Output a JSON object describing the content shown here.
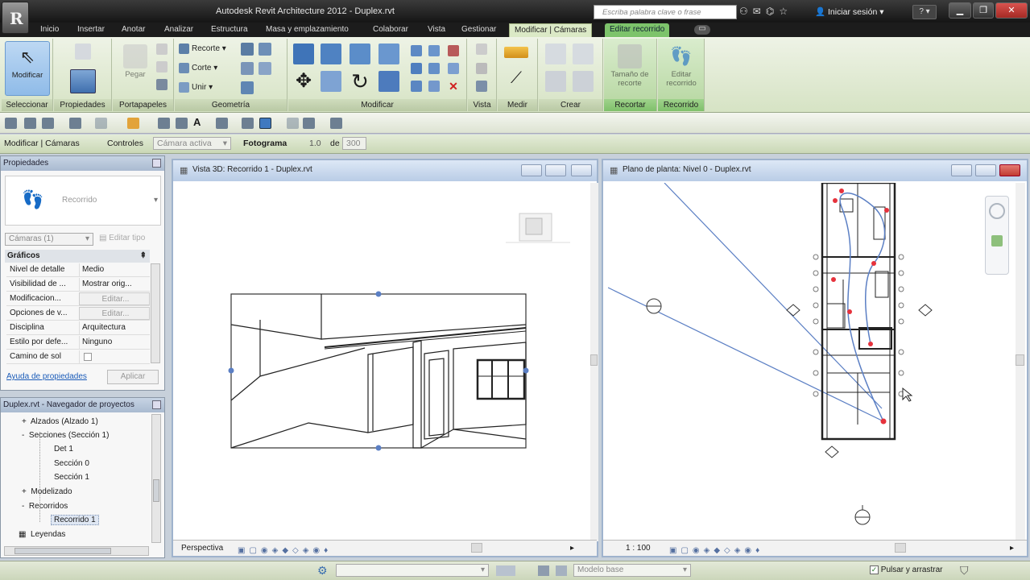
{
  "app": {
    "title": "Autodesk Revit Architecture 2012 -    Duplex.rvt",
    "logo_letter": "R"
  },
  "search": {
    "placeholder": "Escriba palabra clave o frase"
  },
  "account": {
    "login": "Iniciar sesión",
    "help": "?"
  },
  "ribbon_tabs": [
    "Inicio",
    "Insertar",
    "Anotar",
    "Analizar",
    "Estructura",
    "Masa y emplazamiento",
    "Colaborar",
    "Vista",
    "Gestionar",
    "Modificar | Cámaras",
    "Editar recorrido"
  ],
  "ribbon_panels": {
    "seleccionar": {
      "label": "Seleccionar",
      "modify": "Modificar"
    },
    "propiedades": {
      "label": "Propiedades"
    },
    "portapapeles": {
      "label": "Portapapeles",
      "paste": "Pegar"
    },
    "geometria": {
      "label": "Geometría",
      "items": [
        "Recorte",
        "Corte",
        "Unir"
      ]
    },
    "modificar": {
      "label": "Modificar"
    },
    "vista": {
      "label": "Vista"
    },
    "medir": {
      "label": "Medir"
    },
    "crear": {
      "label": "Crear"
    },
    "recortar": {
      "label": "Recortar",
      "button": "Tamaño de recorte"
    },
    "recorrido": {
      "label": "Recorrido",
      "button": "Editar recorrido"
    }
  },
  "options_bar": {
    "context": "Modificar | Cámaras",
    "controls_label": "Controles",
    "controls_value": "Cámara activa",
    "frame_label": "Fotograma",
    "frame_value": "1.0",
    "of_label": "de",
    "frame_total": "300"
  },
  "properties": {
    "header": "Propiedades",
    "type_name": "Recorrido",
    "filter": "Cámaras (1)",
    "edit_type": "Editar tipo",
    "section": "Gráficos",
    "rows": [
      {
        "k": "Nivel de detalle",
        "v": "Medio"
      },
      {
        "k": "Visibilidad de ...",
        "v": "Mostrar orig..."
      },
      {
        "k": "Modificacion...",
        "v": "Editar..."
      },
      {
        "k": "Opciones de v...",
        "v": "Editar..."
      },
      {
        "k": "Disciplina",
        "v": "Arquitectura"
      },
      {
        "k": "Estilo por defe...",
        "v": "Ninguno"
      },
      {
        "k": "Camino de sol",
        "v": ""
      }
    ],
    "help_link": "Ayuda de propiedades",
    "apply": "Aplicar"
  },
  "browser": {
    "header": "Duplex.rvt - Navegador de proyectos",
    "items": [
      {
        "label": "Alzados (Alzado 1)",
        "level": 1,
        "toggle": "+"
      },
      {
        "label": "Secciones (Sección 1)",
        "level": 1,
        "toggle": "-"
      },
      {
        "label": "Det 1",
        "level": 2,
        "toggle": ""
      },
      {
        "label": "Sección 0",
        "level": 2,
        "toggle": ""
      },
      {
        "label": "Sección 1",
        "level": 2,
        "toggle": ""
      },
      {
        "label": "Modelizado",
        "level": 1,
        "toggle": "+"
      },
      {
        "label": "Recorridos",
        "level": 1,
        "toggle": "-"
      },
      {
        "label": "Recorrido 1",
        "level": 2,
        "toggle": ""
      },
      {
        "label": "Leyendas",
        "level": 0,
        "toggle": ""
      }
    ]
  },
  "view3d": {
    "title": "Vista 3D: Recorrido 1 - Duplex.rvt",
    "footer": "Perspectiva"
  },
  "viewplan": {
    "title": "Plano de planta: Nivel 0 - Duplex.rvt",
    "scale": "1 : 100"
  },
  "status_bar": {
    "model": "Modelo base",
    "press_drag": "Pulsar y arrastrar"
  },
  "colors": {
    "ribbon_bg": "#dbe6cb",
    "context_tab": "#7dc36b",
    "view_border": "#9fb3cd",
    "walk_path": "#5b7fc4",
    "path_point": "#e6323c"
  }
}
